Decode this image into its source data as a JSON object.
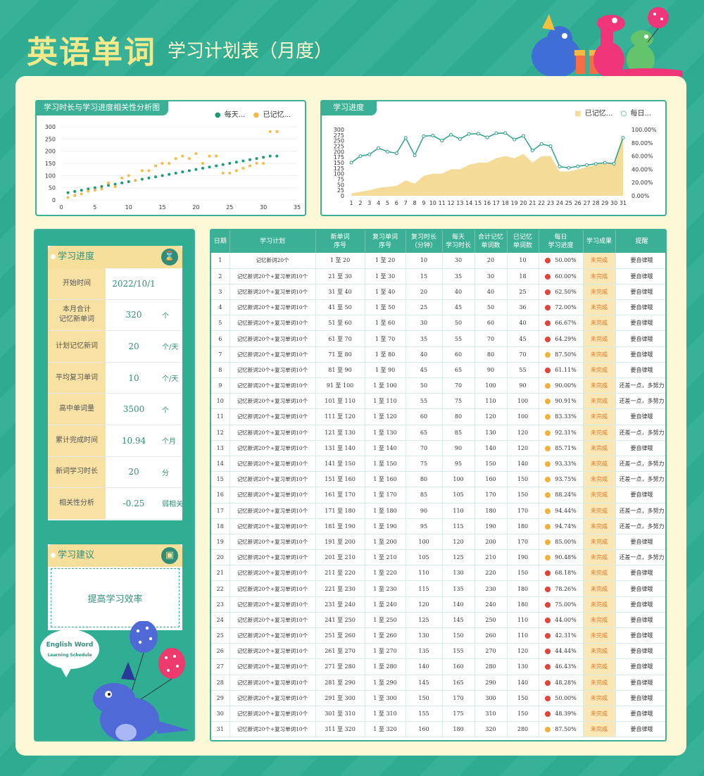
{
  "header": {
    "title": "英语单词",
    "subtitle": "学习计划表（月度）"
  },
  "colors": {
    "accent": "#3cb096",
    "bg": "#2fae93",
    "cream": "#fdf8d6",
    "gold": "#f5c45a",
    "teal_dark": "#2f8f7a"
  },
  "chart1": {
    "tab": "学习时长与学习进度相关性分析图",
    "legend": [
      "每天...",
      "已记忆..."
    ]
  },
  "chart2": {
    "tab": "学习进度",
    "legend": [
      "已记忆...",
      "每日..."
    ]
  },
  "chart_data": [
    {
      "type": "scatter",
      "title": "学习时长与学习进度相关性分析图",
      "xlim": [
        0,
        35
      ],
      "ylim": [
        0,
        300
      ],
      "xticks": [
        0,
        5,
        10,
        15,
        20,
        25,
        30,
        35
      ],
      "yticks": [
        0,
        50,
        100,
        150,
        200,
        250,
        300
      ],
      "grid": true,
      "legend_position": "top-right",
      "series": [
        {
          "name": "每天...",
          "color": "#1f9a77",
          "x": [
            1,
            2,
            3,
            4,
            5,
            6,
            7,
            8,
            9,
            10,
            11,
            12,
            13,
            14,
            15,
            16,
            17,
            18,
            19,
            20,
            21,
            22,
            23,
            24,
            25,
            26,
            27,
            28,
            29,
            30,
            31,
            32
          ],
          "y": [
            30,
            35,
            40,
            45,
            50,
            55,
            60,
            65,
            70,
            75,
            80,
            85,
            90,
            95,
            100,
            105,
            110,
            115,
            120,
            125,
            130,
            135,
            140,
            145,
            150,
            155,
            160,
            165,
            170,
            175,
            180,
            180
          ]
        },
        {
          "name": "已记忆...",
          "color": "#f5b94c",
          "x": [
            1,
            2,
            3,
            4,
            5,
            6,
            7,
            8,
            9,
            10,
            11,
            12,
            13,
            14,
            15,
            16,
            17,
            18,
            19,
            20,
            21,
            22,
            23,
            24,
            25,
            26,
            27,
            28,
            29,
            30,
            31,
            32
          ],
          "y": [
            10,
            18,
            25,
            36,
            40,
            45,
            70,
            55,
            90,
            100,
            80,
            120,
            120,
            140,
            150,
            150,
            170,
            180,
            170,
            190,
            150,
            180,
            180,
            110,
            110,
            120,
            130,
            140,
            150,
            150,
            280,
            280
          ]
        }
      ]
    },
    {
      "type": "area",
      "title": "学习进度",
      "categories": [
        "1",
        "2",
        "3",
        "4",
        "5",
        "6",
        "7",
        "8",
        "9",
        "10",
        "11",
        "12",
        "13",
        "14",
        "15",
        "16",
        "17",
        "18",
        "19",
        "20",
        "21",
        "22",
        "23",
        "24",
        "25",
        "26",
        "27",
        "28",
        "29",
        "30",
        "31"
      ],
      "ylim": [
        0,
        300
      ],
      "y2lim": [
        0,
        100
      ],
      "yticks": [
        0,
        25,
        50,
        75,
        100,
        125,
        150,
        175,
        200,
        225,
        250,
        275,
        300
      ],
      "y2ticks": [
        "0.00%",
        "20.00%",
        "40.00%",
        "60.00%",
        "80.00%",
        "100.00%"
      ],
      "legend_position": "top-right",
      "series": [
        {
          "name": "已记忆...",
          "type": "area",
          "color": "#f4dc98",
          "axis": "left",
          "values": [
            10,
            18,
            25,
            36,
            40,
            45,
            70,
            55,
            90,
            100,
            100,
            120,
            120,
            140,
            150,
            150,
            170,
            180,
            170,
            190,
            150,
            180,
            180,
            110,
            110,
            120,
            130,
            140,
            150,
            150,
            280
          ]
        },
        {
          "name": "每日...",
          "type": "line",
          "color": "#2fa08a",
          "axis": "right",
          "values": [
            50.0,
            60.0,
            62.5,
            72.0,
            66.67,
            64.29,
            87.5,
            61.11,
            90.0,
            90.91,
            83.33,
            92.31,
            85.71,
            93.33,
            93.75,
            88.24,
            94.44,
            94.74,
            85.0,
            90.48,
            68.18,
            78.26,
            75.0,
            44.0,
            42.31,
            44.44,
            46.43,
            48.28,
            50.0,
            48.39,
            87.5
          ]
        }
      ]
    }
  ],
  "progress": {
    "title": "学习进度",
    "icon": "hourglass-icon",
    "rows": [
      {
        "label": "开始时间",
        "value": "2022/10/1",
        "unit": ""
      },
      {
        "label": "本月合计\n记忆新单词",
        "value": "320",
        "unit": "个"
      },
      {
        "label": "计划记忆新词",
        "value": "20",
        "unit": "个/天"
      },
      {
        "label": "平均复习单词",
        "value": "10",
        "unit": "个/天"
      },
      {
        "label": "高中单词量",
        "value": "3500",
        "unit": "个"
      },
      {
        "label": "累计完成时间",
        "value": "10.94",
        "unit": "个月"
      },
      {
        "label": "新词学习时长",
        "value": "20",
        "unit": "分"
      },
      {
        "label": "相关性分析",
        "value": "-0.25",
        "unit": "弱相关"
      }
    ]
  },
  "advice": {
    "title": "学习建议",
    "icon": "board-icon",
    "text": "提高学习效率"
  },
  "badge": {
    "line1": "English Word",
    "line2": "Learning Schedule"
  },
  "table": {
    "headers": [
      "日期",
      "学习计划",
      "新单词\n序号",
      "复习单词\n序号",
      "复习时长\n（分钟）",
      "每天\n学习时长",
      "合计记忆\n单词数",
      "已记忆\n单词数",
      "每日\n学习进度",
      "学习成果",
      "提醒"
    ],
    "rows": [
      [
        "1",
        "记忆新词20个",
        "1 至 20",
        "1 至 20",
        "10",
        "30",
        "20",
        "10",
        "red",
        "50.00%",
        "未完成",
        "要自律哦"
      ],
      [
        "2",
        "记忆新词20个+复习单词10个",
        "21 至 30",
        "1 至 30",
        "15",
        "35",
        "30",
        "18",
        "red",
        "60.00%",
        "未完成",
        "要自律哦"
      ],
      [
        "3",
        "记忆新词20个+复习单词10个",
        "31 至 40",
        "1 至 40",
        "20",
        "40",
        "40",
        "25",
        "red",
        "62.50%",
        "未完成",
        "要自律哦"
      ],
      [
        "4",
        "记忆新词20个+复习单词10个",
        "41 至 50",
        "1 至 50",
        "25",
        "45",
        "50",
        "36",
        "red",
        "72.00%",
        "未完成",
        "要自律哦"
      ],
      [
        "5",
        "记忆新词20个+复习单词10个",
        "51 至 60",
        "1 至 60",
        "30",
        "50",
        "60",
        "40",
        "red",
        "66.67%",
        "未完成",
        "要自律哦"
      ],
      [
        "6",
        "记忆新词20个+复习单词10个",
        "61 至 70",
        "1 至 70",
        "35",
        "55",
        "70",
        "45",
        "red",
        "64.29%",
        "未完成",
        "要自律哦"
      ],
      [
        "7",
        "记忆新词20个+复习单词10个",
        "71 至 80",
        "1 至 80",
        "40",
        "60",
        "80",
        "70",
        "yellow",
        "87.50%",
        "未完成",
        "要自律哦"
      ],
      [
        "8",
        "记忆新词20个+复习单词10个",
        "81 至 90",
        "1 至 90",
        "45",
        "65",
        "90",
        "55",
        "red",
        "61.11%",
        "未完成",
        "要自律哦"
      ],
      [
        "9",
        "记忆新词20个+复习单词10个",
        "91 至 100",
        "1 至 100",
        "50",
        "70",
        "100",
        "90",
        "yellow",
        "90.00%",
        "未完成",
        "还差一点，多努力"
      ],
      [
        "10",
        "记忆新词20个+复习单词10个",
        "101 至 110",
        "1 至 110",
        "55",
        "75",
        "110",
        "100",
        "yellow",
        "90.91%",
        "未完成",
        "还差一点，多努力"
      ],
      [
        "11",
        "记忆新词20个+复习单词10个",
        "111 至 120",
        "1 至 120",
        "60",
        "80",
        "120",
        "100",
        "yellow",
        "83.33%",
        "未完成",
        "要自律哦"
      ],
      [
        "12",
        "记忆新词20个+复习单词10个",
        "121 至 130",
        "1 至 130",
        "65",
        "85",
        "130",
        "120",
        "yellow",
        "92.31%",
        "未完成",
        "还差一点，多努力"
      ],
      [
        "13",
        "记忆新词20个+复习单词10个",
        "131 至 140",
        "1 至 140",
        "70",
        "90",
        "140",
        "120",
        "yellow",
        "85.71%",
        "未完成",
        "要自律哦"
      ],
      [
        "14",
        "记忆新词20个+复习单词10个",
        "141 至 150",
        "1 至 150",
        "75",
        "95",
        "150",
        "140",
        "yellow",
        "93.33%",
        "未完成",
        "还差一点，多努力"
      ],
      [
        "15",
        "记忆新词20个+复习单词10个",
        "151 至 160",
        "1 至 160",
        "80",
        "100",
        "160",
        "150",
        "yellow",
        "93.75%",
        "未完成",
        "还差一点，多努力"
      ],
      [
        "16",
        "记忆新词20个+复习单词10个",
        "161 至 170",
        "1 至 170",
        "85",
        "105",
        "170",
        "150",
        "yellow",
        "88.24%",
        "未完成",
        "要自律哦"
      ],
      [
        "17",
        "记忆新词20个+复习单词10个",
        "171 至 180",
        "1 至 180",
        "90",
        "110",
        "180",
        "170",
        "yellow",
        "94.44%",
        "未完成",
        "还差一点，多努力"
      ],
      [
        "18",
        "记忆新词20个+复习单词10个",
        "181 至 190",
        "1 至 190",
        "95",
        "115",
        "190",
        "180",
        "yellow",
        "94.74%",
        "未完成",
        "还差一点，多努力"
      ],
      [
        "19",
        "记忆新词20个+复习单词10个",
        "191 至 200",
        "1 至 200",
        "100",
        "120",
        "200",
        "170",
        "yellow",
        "85.00%",
        "未完成",
        "要自律哦"
      ],
      [
        "20",
        "记忆新词20个+复习单词10个",
        "201 至 210",
        "1 至 210",
        "105",
        "125",
        "210",
        "190",
        "yellow",
        "90.48%",
        "未完成",
        "还差一点，多努力"
      ],
      [
        "21",
        "记忆新词20个+复习单词10个",
        "211 至 220",
        "1 至 220",
        "110",
        "130",
        "220",
        "150",
        "red",
        "68.18%",
        "未完成",
        "要自律哦"
      ],
      [
        "22",
        "记忆新词20个+复习单词10个",
        "221 至 230",
        "1 至 230",
        "115",
        "135",
        "230",
        "180",
        "red",
        "78.26%",
        "未完成",
        "要自律哦"
      ],
      [
        "23",
        "记忆新词20个+复习单词10个",
        "231 至 240",
        "1 至 240",
        "120",
        "140",
        "240",
        "180",
        "red",
        "75.00%",
        "未完成",
        "要自律哦"
      ],
      [
        "24",
        "记忆新词20个+复习单词10个",
        "241 至 250",
        "1 至 250",
        "125",
        "145",
        "250",
        "110",
        "red",
        "44.00%",
        "未完成",
        "要自律哦"
      ],
      [
        "25",
        "记忆新词20个+复习单词10个",
        "251 至 260",
        "1 至 260",
        "130",
        "150",
        "260",
        "110",
        "red",
        "42.31%",
        "未完成",
        "要自律哦"
      ],
      [
        "26",
        "记忆新词20个+复习单词10个",
        "261 至 270",
        "1 至 270",
        "135",
        "155",
        "270",
        "120",
        "red",
        "44.44%",
        "未完成",
        "要自律哦"
      ],
      [
        "27",
        "记忆新词20个+复习单词10个",
        "271 至 280",
        "1 至 280",
        "140",
        "160",
        "280",
        "130",
        "red",
        "46.43%",
        "未完成",
        "要自律哦"
      ],
      [
        "28",
        "记忆新词20个+复习单词10个",
        "281 至 290",
        "1 至 290",
        "145",
        "165",
        "290",
        "140",
        "red",
        "48.28%",
        "未完成",
        "要自律哦"
      ],
      [
        "29",
        "记忆新词20个+复习单词10个",
        "291 至 300",
        "1 至 300",
        "150",
        "170",
        "300",
        "150",
        "red",
        "50.00%",
        "未完成",
        "要自律哦"
      ],
      [
        "30",
        "记忆新词20个+复习单词10个",
        "301 至 310",
        "1 至 310",
        "155",
        "175",
        "310",
        "150",
        "red",
        "48.39%",
        "未完成",
        "要自律哦"
      ],
      [
        "31",
        "记忆新词20个+复习单词10个",
        "311 至 320",
        "1 至 320",
        "160",
        "180",
        "320",
        "280",
        "yellow",
        "87.50%",
        "未完成",
        "要自律哦"
      ]
    ]
  }
}
